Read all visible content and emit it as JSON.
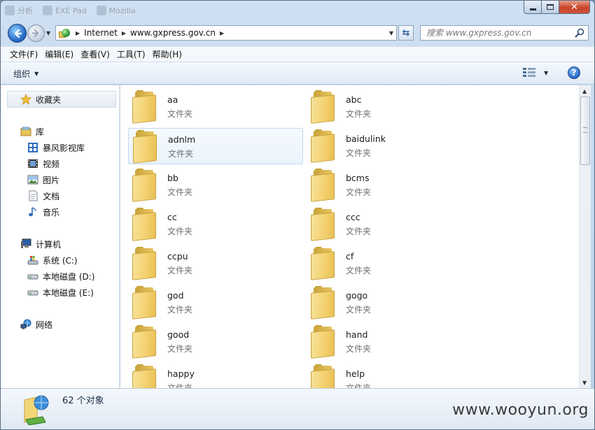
{
  "titlebar": {
    "ghost_tabs": [
      "分析",
      "EXE Pad",
      "Mozilla"
    ]
  },
  "address": {
    "crumbs": [
      "Internet",
      "www.gxpress.gov.cn"
    ]
  },
  "search": {
    "placeholder": "搜索 www.gxpress.gov.cn"
  },
  "menubar": {
    "items": [
      "文件(F)",
      "编辑(E)",
      "查看(V)",
      "工具(T)",
      "帮助(H)"
    ]
  },
  "toolbar": {
    "organize_label": "组织"
  },
  "navpane": {
    "favorites": "收藏夹",
    "libraries": {
      "label": "库",
      "items": [
        "暴风影视库",
        "视频",
        "图片",
        "文档",
        "音乐"
      ]
    },
    "computer": {
      "label": "计算机",
      "items": [
        "系统 (C:)",
        "本地磁盘 (D:)",
        "本地磁盘 (E:)"
      ]
    },
    "network": "网络"
  },
  "files": [
    {
      "name": "aa",
      "type": "文件夹"
    },
    {
      "name": "abc",
      "type": "文件夹"
    },
    {
      "name": "adnlm",
      "type": "文件夹",
      "selected": true
    },
    {
      "name": "baidulink",
      "type": "文件夹"
    },
    {
      "name": "bb",
      "type": "文件夹"
    },
    {
      "name": "bcms",
      "type": "文件夹"
    },
    {
      "name": "cc",
      "type": "文件夹"
    },
    {
      "name": "ccc",
      "type": "文件夹"
    },
    {
      "name": "ccpu",
      "type": "文件夹"
    },
    {
      "name": "cf",
      "type": "文件夹"
    },
    {
      "name": "god",
      "type": "文件夹"
    },
    {
      "name": "gogo",
      "type": "文件夹"
    },
    {
      "name": "good",
      "type": "文件夹"
    },
    {
      "name": "hand",
      "type": "文件夹"
    },
    {
      "name": "happy",
      "type": "文件夹"
    },
    {
      "name": "help",
      "type": "文件夹"
    }
  ],
  "details": {
    "count_text": "62 个对象"
  },
  "watermark": "www.wooyun.org",
  "colors": {
    "accent": "#2a6fc9",
    "close_button": "#c8442a",
    "folder": "#f4d271"
  }
}
